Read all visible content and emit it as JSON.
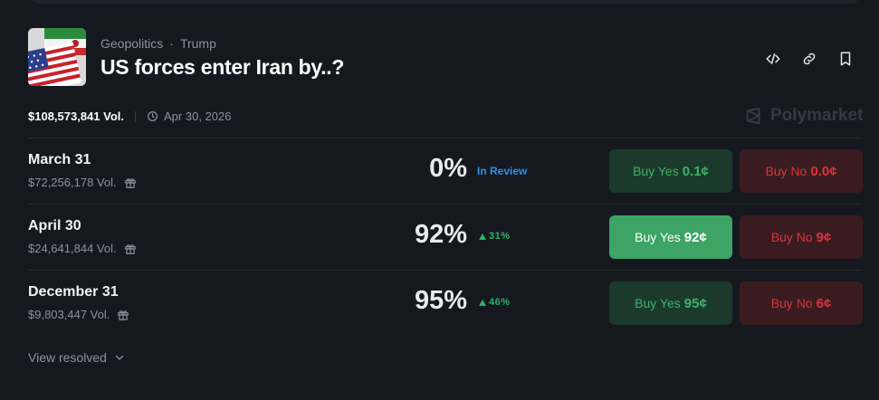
{
  "header": {
    "breadcrumb": [
      "Geopolitics",
      "Trump"
    ],
    "breadcrumb_separator": "·",
    "title": "US forces enter Iran by..?",
    "actions": [
      "embed-icon",
      "link-icon",
      "bookmark-icon"
    ]
  },
  "meta": {
    "volume": "$108,573,841 Vol.",
    "end_date": "Apr 30, 2026",
    "brand": "Polymarket"
  },
  "outcomes": [
    {
      "label": "March 31",
      "volume": "$72,256,178 Vol.",
      "percent": "0%",
      "status": "In Review",
      "change": "",
      "buy_yes_label": "Buy Yes",
      "buy_yes_price": "0.1¢",
      "buy_no_label": "Buy No",
      "buy_no_price": "0.0¢",
      "yes_active": false
    },
    {
      "label": "April 30",
      "volume": "$24,641,844 Vol.",
      "percent": "92%",
      "status": "",
      "change": "31%",
      "buy_yes_label": "Buy Yes",
      "buy_yes_price": "92¢",
      "buy_no_label": "Buy No",
      "buy_no_price": "9¢",
      "yes_active": true
    },
    {
      "label": "December 31",
      "volume": "$9,803,447 Vol.",
      "percent": "95%",
      "status": "",
      "change": "46%",
      "buy_yes_label": "Buy Yes",
      "buy_yes_price": "95¢",
      "buy_no_label": "Buy No",
      "buy_no_price": "6¢",
      "yes_active": false
    }
  ],
  "footer": {
    "view_resolved": "View resolved"
  },
  "colors": {
    "background": "#15191f",
    "yes_green": "#3ea465",
    "no_red": "#d7353c",
    "change_green": "#2fb16a",
    "review_blue": "#2f8fe6"
  }
}
